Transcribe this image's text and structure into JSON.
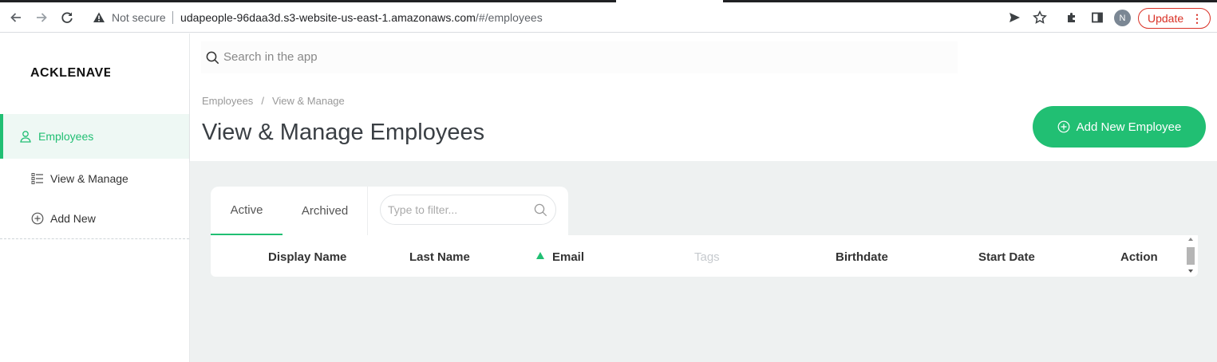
{
  "browser": {
    "security_label": "Not secure",
    "url_host": "udapeople-96daa3d.s3-website-us-east-1.amazonaws.com",
    "url_path": "/#/employees",
    "profile_initial": "N",
    "update_label": "Update",
    "menu_glyph": "⋮",
    "icons": [
      "back-icon",
      "forward-icon",
      "reload-icon",
      "warning-icon",
      "send-icon",
      "star-icon",
      "extensions-icon",
      "side-panel-icon"
    ]
  },
  "sidebar": {
    "logo": "ACKLENAVENUE",
    "items": [
      {
        "label": "Employees",
        "icon": "user-icon",
        "active": true
      },
      {
        "label": "View & Manage",
        "icon": "list-icon",
        "active": false
      },
      {
        "label": "Add New",
        "icon": "plus-circle-icon",
        "active": false
      }
    ]
  },
  "search": {
    "placeholder": "Search in the app"
  },
  "header": {
    "breadcrumb": [
      "Employees",
      "View & Manage"
    ],
    "breadcrumb_separator": "/",
    "title": "View & Manage Employees",
    "add_button_label": "Add New Employee"
  },
  "tabs": [
    {
      "label": "Active",
      "active": true
    },
    {
      "label": "Archived",
      "active": false
    }
  ],
  "filter": {
    "placeholder": "Type to filter..."
  },
  "table": {
    "columns": [
      "Display Name",
      "Last Name",
      "Email",
      "Tags",
      "Birthdate",
      "Start Date",
      "Action"
    ],
    "sorted_column": "Email",
    "sort_direction": "ascending"
  },
  "colors": {
    "accent": "#21bf73",
    "content_bg": "#eef1f1",
    "danger": "#d93025"
  }
}
